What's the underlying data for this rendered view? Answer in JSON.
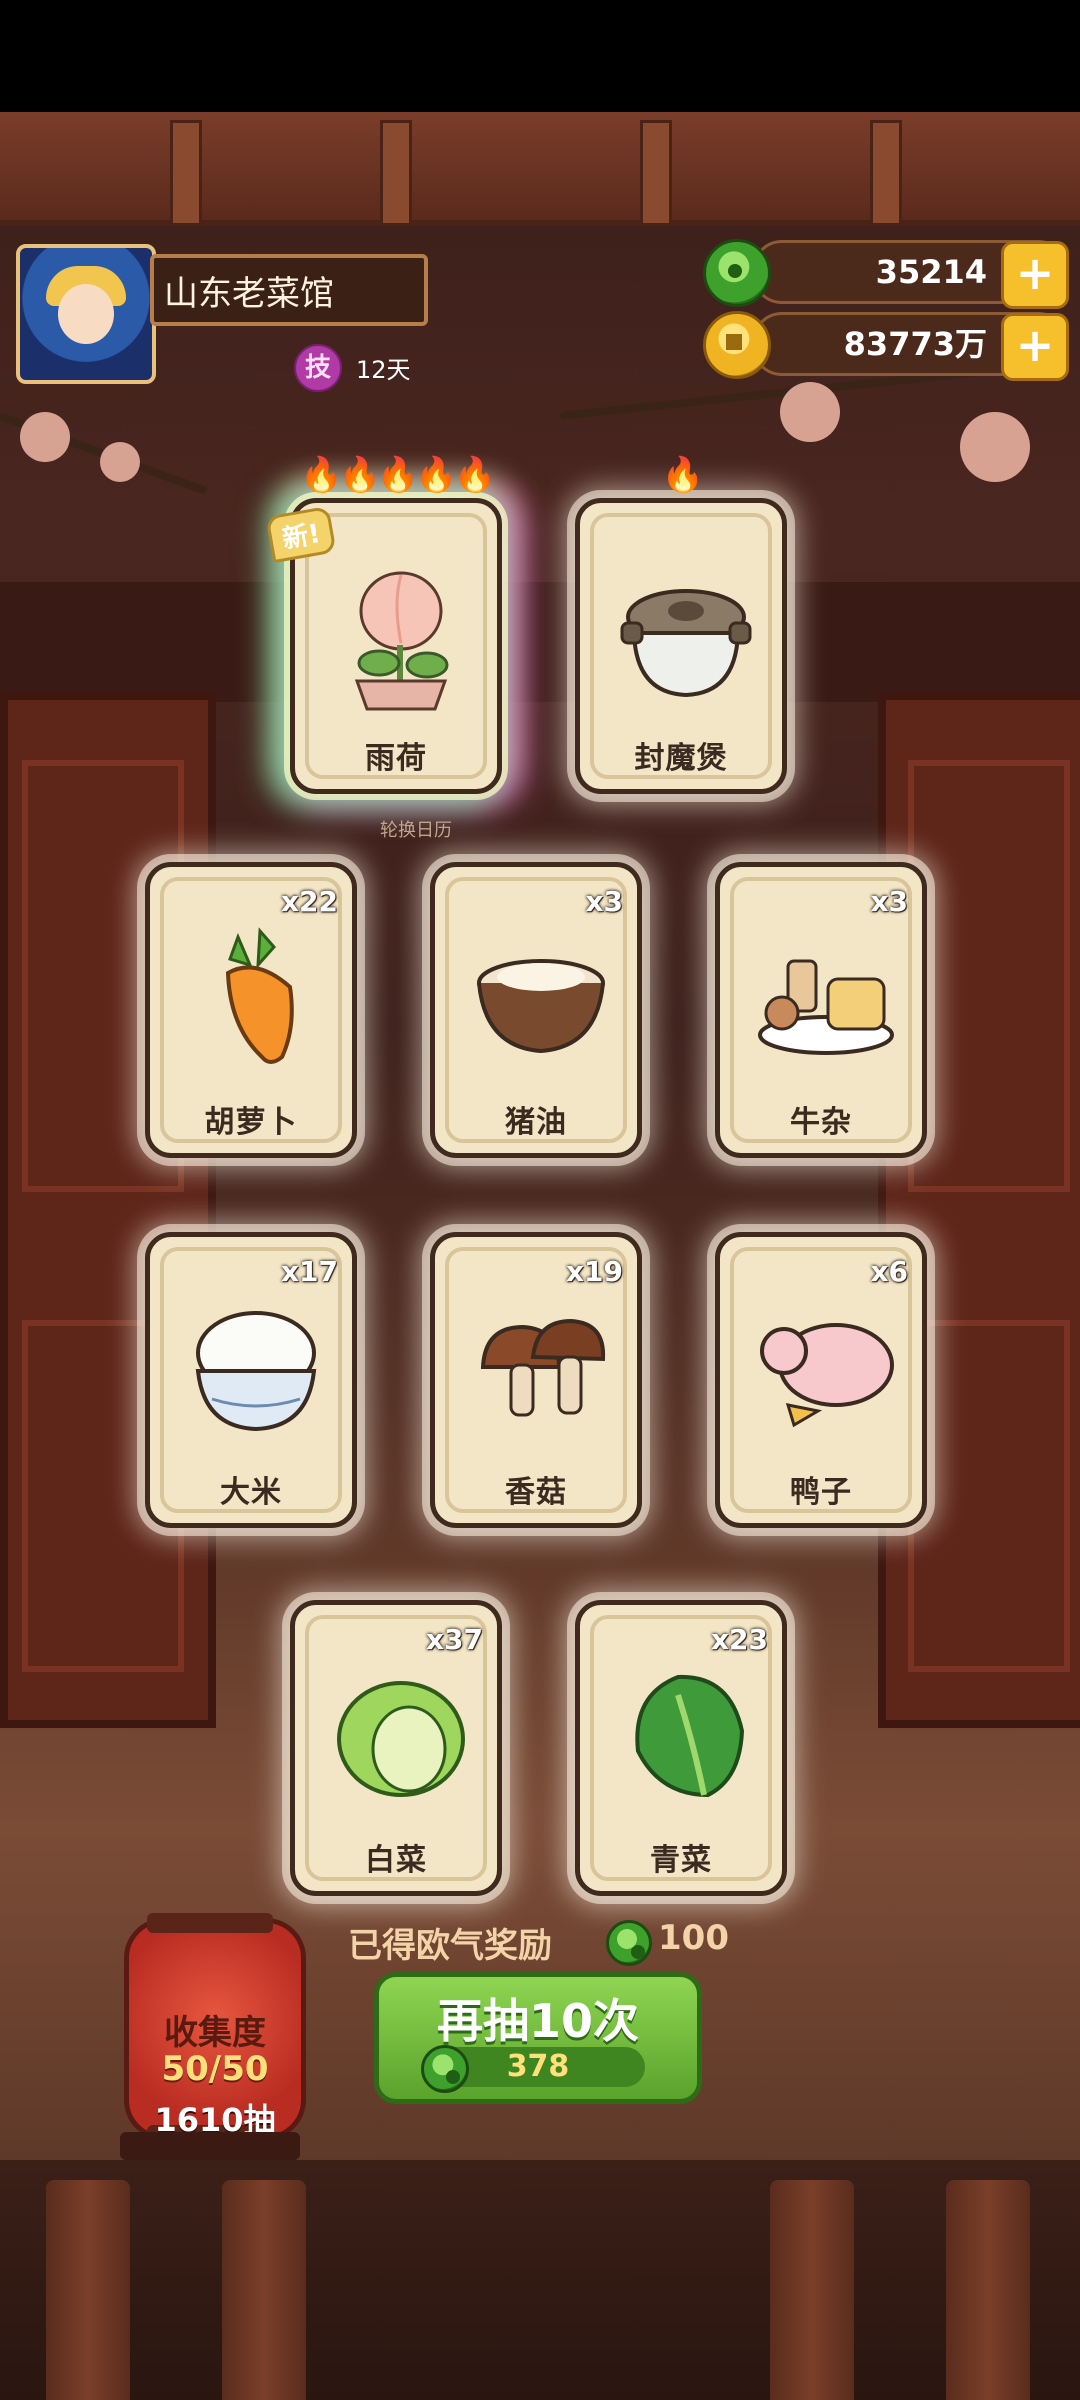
{
  "restaurant_name": "山东老菜馆",
  "skill": {
    "icon_text": "技",
    "days": "12天"
  },
  "currencies": {
    "jade": "35214",
    "gold": "83773万"
  },
  "featured_cards": [
    {
      "label": "雨荷",
      "flames": "🔥🔥🔥🔥🔥",
      "new_tag": "新!",
      "subtext": "轮换日历"
    },
    {
      "label": "封魔煲",
      "flames": "🔥"
    }
  ],
  "cards": [
    {
      "label": "胡萝卜",
      "count": "x22"
    },
    {
      "label": "猪油",
      "count": "x3"
    },
    {
      "label": "牛杂",
      "count": "x3"
    },
    {
      "label": "大米",
      "count": "x17"
    },
    {
      "label": "香菇",
      "count": "x19"
    },
    {
      "label": "鸭子",
      "count": "x6"
    },
    {
      "label": "白菜",
      "count": "x37"
    },
    {
      "label": "青菜",
      "count": "x23"
    }
  ],
  "collection": {
    "title": "收集度",
    "progress": "50/50",
    "draws": "1610抽"
  },
  "reward": {
    "label": "已得欧气奖励",
    "value": "100"
  },
  "draw_button": {
    "label": "再抽10次",
    "cost": "378"
  },
  "colors": {
    "jade": "#3ea12b",
    "gold": "#f0b321",
    "button_green": "#6fbe3a",
    "card_bg": "#f3e6c6"
  }
}
